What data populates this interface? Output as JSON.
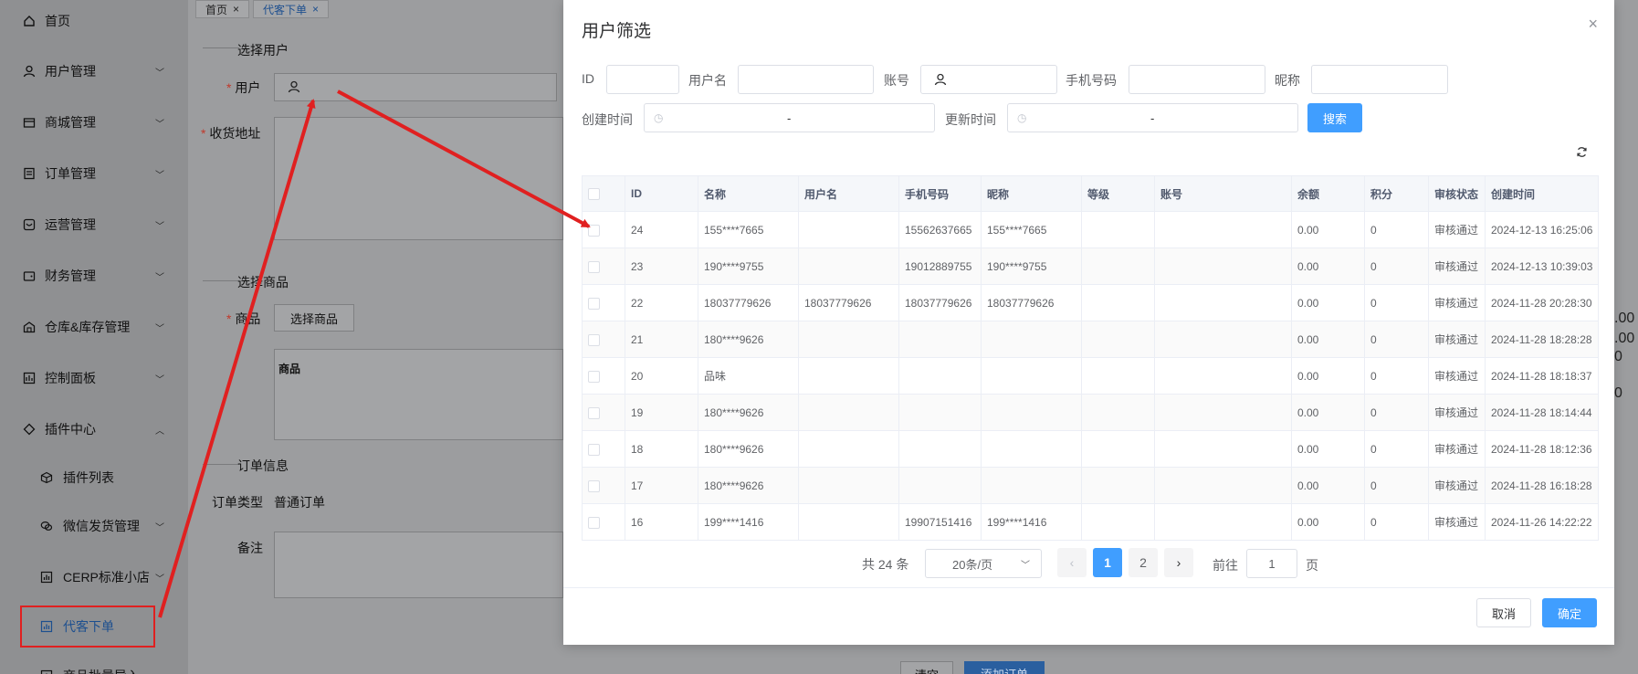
{
  "sidebar": {
    "items": [
      {
        "label": "首页",
        "icon": "home-icon"
      },
      {
        "label": "用户管理",
        "icon": "user-icon"
      },
      {
        "label": "商城管理",
        "icon": "shop-icon"
      },
      {
        "label": "订单管理",
        "icon": "order-icon"
      },
      {
        "label": "运营管理",
        "icon": "operation-icon"
      },
      {
        "label": "财务管理",
        "icon": "wallet-icon"
      },
      {
        "label": "仓库&库存管理",
        "icon": "warehouse-icon"
      },
      {
        "label": "控制面板",
        "icon": "dashboard-icon"
      },
      {
        "label": "插件中心",
        "icon": "plugin-icon"
      }
    ],
    "sub_items": [
      {
        "label": "插件列表",
        "icon": "cube-icon"
      },
      {
        "label": "微信发货管理",
        "icon": "wechat-icon"
      },
      {
        "label": "CERP标准小店",
        "icon": "chart-icon"
      },
      {
        "label": "代客下单",
        "icon": "chart-icon"
      },
      {
        "label": "商品批量导入",
        "icon": "chart-icon"
      }
    ]
  },
  "tabs": [
    {
      "label": "首页",
      "close": "×"
    },
    {
      "label": "代客下单",
      "close": "×"
    }
  ],
  "page": {
    "section_user": "选择用户",
    "user_label": "用户",
    "address_label": "收货地址",
    "section_goods": "选择商品",
    "goods_label": "商品",
    "select_goods_button": "选择商品",
    "goods_table_header": "商品",
    "section_order": "订单信息",
    "order_type_label": "订单类型",
    "order_type_value": "普通订单",
    "remark_label": "备注",
    "clear_button": "清空",
    "add_order_button": "添加订单",
    "overflow_values": [
      ".00",
      ".00",
      "0",
      "0"
    ]
  },
  "modal": {
    "title": "用户筛选",
    "close": "×",
    "filters": {
      "id_label": "ID",
      "username_label": "用户名",
      "account_label": "账号",
      "phone_label": "手机号码",
      "nickname_label": "昵称",
      "created_label": "创建时间",
      "updated_label": "更新时间",
      "range_sep": "-",
      "search_button": "搜索"
    },
    "columns": [
      "ID",
      "名称",
      "用户名",
      "手机号码",
      "昵称",
      "等级",
      "账号",
      "余额",
      "积分",
      "审核状态",
      "创建时间"
    ],
    "rows": [
      [
        "24",
        "155****7665",
        "",
        "15562637665",
        "155****7665",
        "",
        "",
        "0.00",
        "0",
        "审核通过",
        "2024-12-13 16:25:06"
      ],
      [
        "23",
        "190****9755",
        "",
        "19012889755",
        "190****9755",
        "",
        "",
        "0.00",
        "0",
        "审核通过",
        "2024-12-13 10:39:03"
      ],
      [
        "22",
        "18037779626",
        "18037779626",
        "18037779626",
        "18037779626",
        "",
        "",
        "0.00",
        "0",
        "审核通过",
        "2024-11-28 20:28:30"
      ],
      [
        "21",
        "180****9626",
        "",
        "",
        "",
        "",
        "",
        "0.00",
        "0",
        "审核通过",
        "2024-11-28 18:28:28"
      ],
      [
        "20",
        "品味",
        "",
        "",
        "",
        "",
        "",
        "0.00",
        "0",
        "审核通过",
        "2024-11-28 18:18:37"
      ],
      [
        "19",
        "180****9626",
        "",
        "",
        "",
        "",
        "",
        "0.00",
        "0",
        "审核通过",
        "2024-11-28 18:14:44"
      ],
      [
        "18",
        "180****9626",
        "",
        "",
        "",
        "",
        "",
        "0.00",
        "0",
        "审核通过",
        "2024-11-28 18:12:36"
      ],
      [
        "17",
        "180****9626",
        "",
        "",
        "",
        "",
        "",
        "0.00",
        "0",
        "审核通过",
        "2024-11-28 16:18:28"
      ],
      [
        "16",
        "199****1416",
        "",
        "19907151416",
        "199****1416",
        "",
        "",
        "0.00",
        "0",
        "审核通过",
        "2024-11-26 14:22:22"
      ]
    ],
    "pagination": {
      "total": "共 24 条",
      "page_size": "20条/页",
      "prev": "‹",
      "pages": [
        "1",
        "2"
      ],
      "next": "›",
      "goto_label": "前往",
      "goto_value": "1",
      "page_unit": "页"
    },
    "cancel_button": "取消",
    "confirm_button": "确定"
  },
  "colors": {
    "primary": "#409eff",
    "annotation": "#e02020",
    "active_menu": "#1d4f8f"
  }
}
